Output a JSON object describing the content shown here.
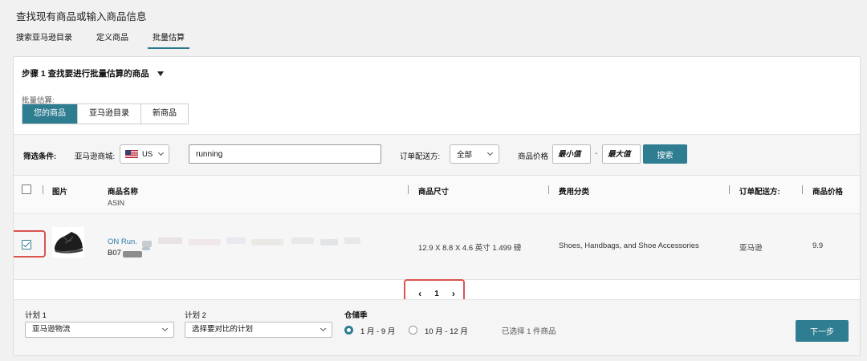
{
  "header": {
    "title": "查找现有商品或输入商品信息",
    "tabs": [
      {
        "label": "搜索亚马逊目录",
        "active": false
      },
      {
        "label": "定义商品",
        "active": false
      },
      {
        "label": "批量估算",
        "active": true
      }
    ]
  },
  "step": {
    "title": "步骤 1 查找要进行批量估算的商品",
    "bulk_label": "批量估算:",
    "segments": [
      {
        "label": "您的商品",
        "active": true
      },
      {
        "label": "亚马逊目录",
        "active": false
      },
      {
        "label": "新商品",
        "active": false
      }
    ]
  },
  "filters": {
    "label": "筛选条件:",
    "marketplace_label": "亚马逊商城:",
    "marketplace_value": "US",
    "search_value": "running",
    "fulfillment_label": "订单配送方:",
    "fulfillment_value": "全部",
    "price_label": "商品价格",
    "min_placeholder": "最小值",
    "max_placeholder": "最大值",
    "dash": "-",
    "search_button": "搜索"
  },
  "table": {
    "headers": {
      "image": "图片",
      "name": "商品名称",
      "asin": "ASIN",
      "dimensions": "商品尺寸",
      "fee_category": "费用分类",
      "fulfillment": "订单配送方:",
      "price": "商品价格"
    },
    "rows": [
      {
        "checked": true,
        "name": "ON Run.",
        "asin": "B07",
        "dimensions": "12.9 X 8.8 X 4.6 英寸 1.499 磅",
        "fee_category": "Shoes, Handbags, and Shoe Accessories",
        "fulfillment": "亚马逊",
        "price": "9.9"
      }
    ]
  },
  "pagination": {
    "prev": "‹",
    "page": "1",
    "next": "›"
  },
  "bottom": {
    "plan1_label": "计划 1",
    "plan1_value": "亚马逊物流",
    "plan2_label": "计划 2",
    "plan2_value": "选择要对比的计划",
    "season_label": "仓储季",
    "season_options": [
      {
        "label": "1 月 - 9 月",
        "selected": true
      },
      {
        "label": "10 月 - 12 月",
        "selected": false
      }
    ],
    "selected_count": "已选择 1 件商品",
    "next_button": "下一步"
  },
  "colors": {
    "accent": "#2e7d91",
    "link": "#2b7aa5",
    "highlight": "#d9534f"
  }
}
